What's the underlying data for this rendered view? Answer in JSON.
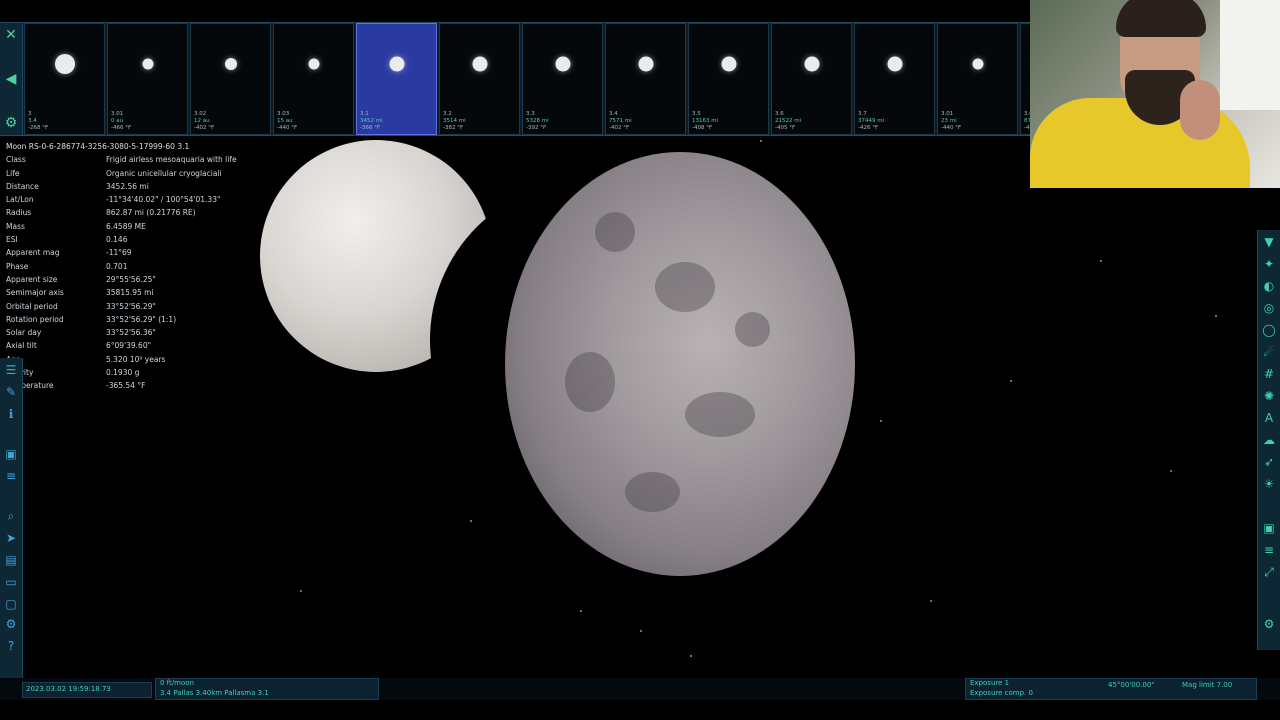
{
  "topbar": {
    "close_icon": "close-icon",
    "nav_icon": "arrow-left-icon",
    "settings_icon": "gear-icon",
    "thumbnails": [
      {
        "name": "3",
        "line1": "3.4",
        "line2": "-268 °F",
        "size": 20,
        "selected": false
      },
      {
        "name": "3.01",
        "line1": "0 au",
        "line2": "-466 °F",
        "size": 11,
        "selected": false
      },
      {
        "name": "3.02",
        "line1": "12 au",
        "line2": "-402 °F",
        "size": 12,
        "selected": false
      },
      {
        "name": "3.03",
        "line1": "15 au",
        "line2": "-440 °F",
        "size": 11,
        "selected": false
      },
      {
        "name": "3.1",
        "line1": "3452 mi",
        "line2": "-366 °F",
        "size": 15,
        "selected": true
      },
      {
        "name": "3.2",
        "line1": "3514 mi",
        "line2": "-382 °F",
        "size": 15,
        "selected": false
      },
      {
        "name": "3.3",
        "line1": "5328 mi",
        "line2": "-392 °F",
        "size": 15,
        "selected": false
      },
      {
        "name": "3.4",
        "line1": "7571 mi",
        "line2": "-402 °F",
        "size": 15,
        "selected": false
      },
      {
        "name": "3.5",
        "line1": "13163 mi",
        "line2": "-408 °F",
        "size": 15,
        "selected": false
      },
      {
        "name": "3.6",
        "line1": "21522 mi",
        "line2": "-405 °F",
        "size": 15,
        "selected": false
      },
      {
        "name": "3.7",
        "line1": "37449 mi",
        "line2": "-426 °F",
        "size": 15,
        "selected": false
      },
      {
        "name": "3.01",
        "line1": "23 mi",
        "line2": "-440 °F",
        "size": 11,
        "selected": false
      },
      {
        "name": "3.03",
        "line1": "87 mi",
        "line2": "-440 °F",
        "size": 11,
        "selected": false
      }
    ]
  },
  "info": {
    "title": "Moon  RS-0-6-286774-3256-3080-5-17999-60 3.1",
    "rows": [
      {
        "label": "Class",
        "value": "Frigid airless mesoaquaria with life"
      },
      {
        "label": "Life",
        "value": "Organic unicellular cryoglaciali"
      },
      {
        "label": "Distance",
        "value": "3452.56 mi"
      },
      {
        "label": "Lat/Lon",
        "value": "-11°34'40.02\" / 100°54'01.33\""
      },
      {
        "label": "Radius",
        "value": "862.87 mi (0.21776 RE)"
      },
      {
        "label": "Mass",
        "value": "6.4589 ME"
      },
      {
        "label": "ESI",
        "value": "0.146"
      },
      {
        "label": "Apparent mag",
        "value": "-11°69"
      },
      {
        "label": "Phase",
        "value": "0.701"
      },
      {
        "label": "Apparent size",
        "value": "29°55'56.25\""
      },
      {
        "label": "Semimajor axis",
        "value": "35815.95 mi"
      },
      {
        "label": "Orbital period",
        "value": "33°52'56.29\""
      },
      {
        "label": "Rotation period",
        "value": "33°52'56.29\" (1:1)"
      },
      {
        "label": "Solar day",
        "value": "33°52'56.36\""
      },
      {
        "label": "Axial tilt",
        "value": "6°09'39.60\""
      },
      {
        "label": "Age",
        "value": "5.320 10⁹ years"
      },
      {
        "label": "Gravity",
        "value": "0.1930 g"
      },
      {
        "label": "Temperature",
        "value": "-365.54 °F"
      }
    ]
  },
  "status": {
    "date": "2023.03.02 19:59:18.73",
    "speed": "0 ft/moon",
    "target": "3.4 Pallas 3.40km Pallasma 3.1",
    "exposure": "Exposure 1",
    "exposure_comp": "Exposure comp. 0",
    "fov": "45°00'00.00\"",
    "mag": "Mag limit 7.00"
  },
  "colors": {
    "accent": "#3fd0b0",
    "selected": "#2a3aa0",
    "panel": "#0d2735"
  }
}
